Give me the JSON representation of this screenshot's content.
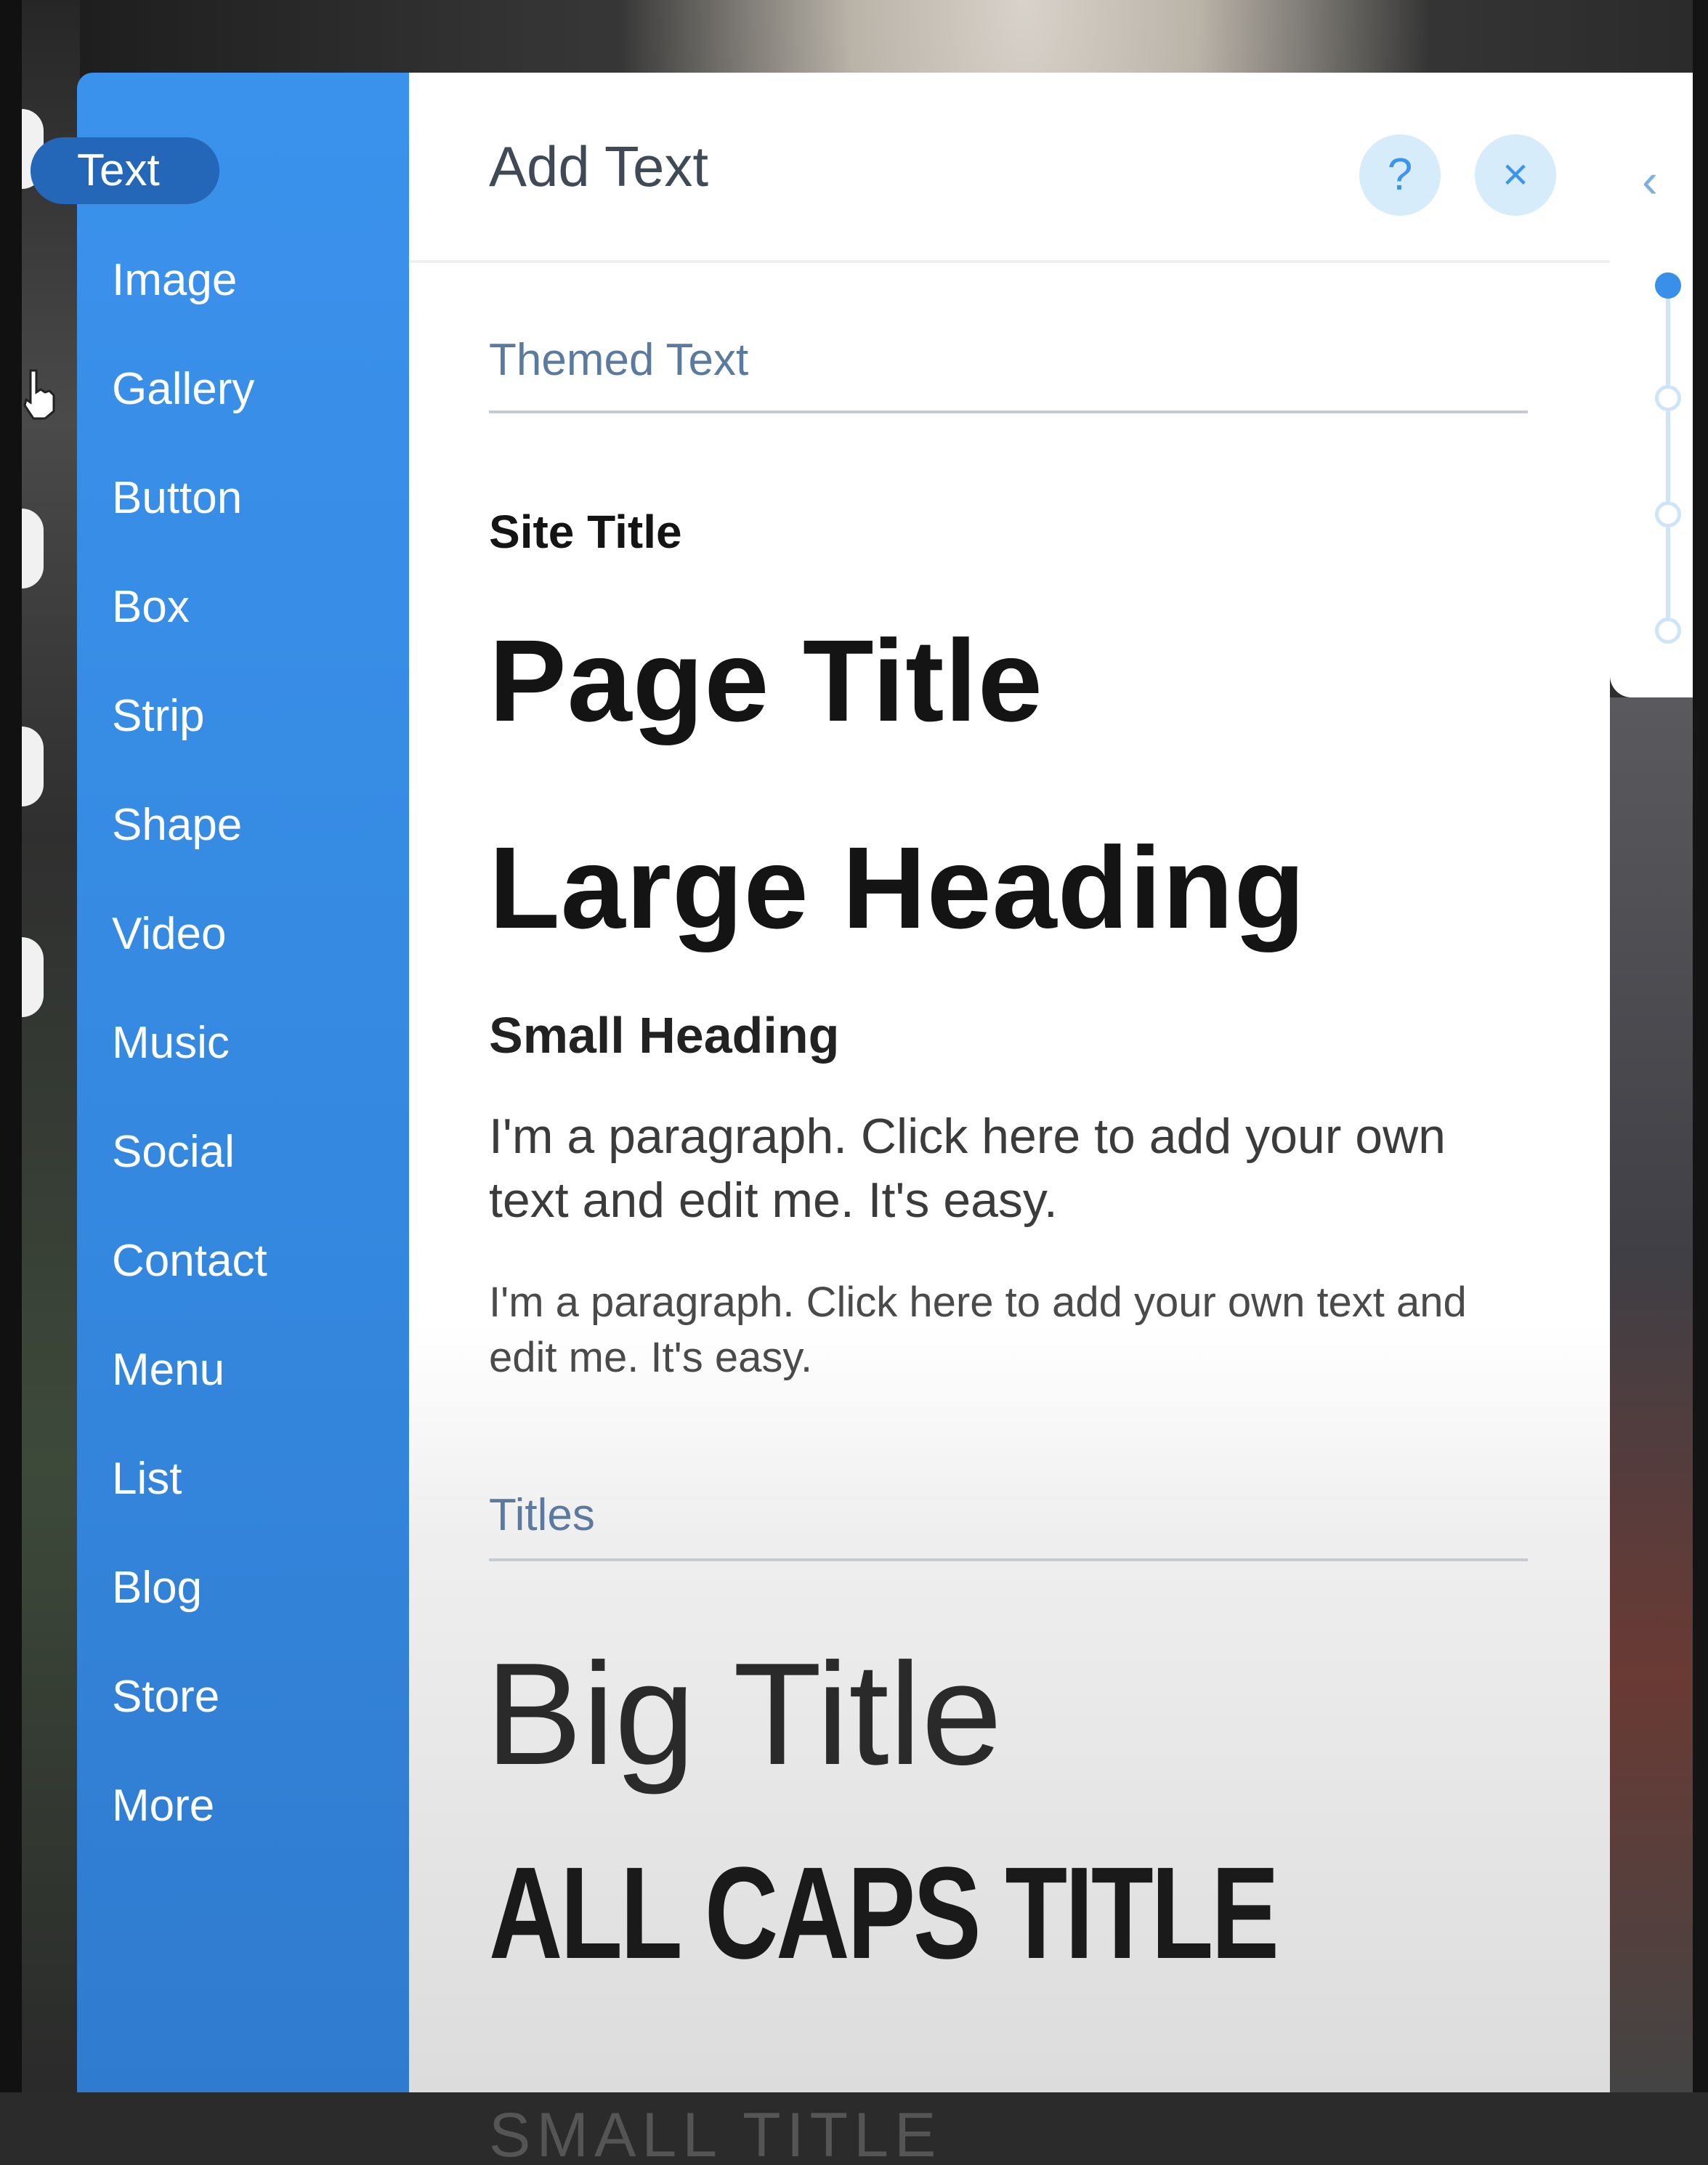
{
  "sidebar": {
    "items": [
      {
        "label": "Text",
        "active": true
      },
      {
        "label": "Image"
      },
      {
        "label": "Gallery"
      },
      {
        "label": "Button"
      },
      {
        "label": "Box"
      },
      {
        "label": "Strip"
      },
      {
        "label": "Shape"
      },
      {
        "label": "Video"
      },
      {
        "label": "Music"
      },
      {
        "label": "Social"
      },
      {
        "label": "Contact"
      },
      {
        "label": "Menu"
      },
      {
        "label": "List"
      },
      {
        "label": "Blog"
      },
      {
        "label": "Store"
      },
      {
        "label": "More"
      }
    ]
  },
  "panel": {
    "title": "Add Text",
    "help_icon": "?",
    "close_icon": "×",
    "themed_section_label": "Themed Text",
    "site_title": "Site Title",
    "page_title": "Page Title",
    "large_heading": "Large Heading",
    "small_heading": "Small Heading",
    "paragraph_1": "I'm a paragraph. Click here to add your own text and edit me. It's easy.",
    "paragraph_2": "I'm a paragraph. Click here to add your own text and edit me. It's easy.",
    "titles_section_label": "Titles",
    "big_title": "Big Title",
    "all_caps_title": "ALL CAPS TITLE",
    "small_title": "SMALL TITLE"
  },
  "rail": {
    "collapse_icon": "‹",
    "steps": 4,
    "active_step": 1
  },
  "colors": {
    "sidebar_blue": "#3b92ec",
    "active_item": "#2467b8",
    "accent": "#3a8fe8"
  }
}
